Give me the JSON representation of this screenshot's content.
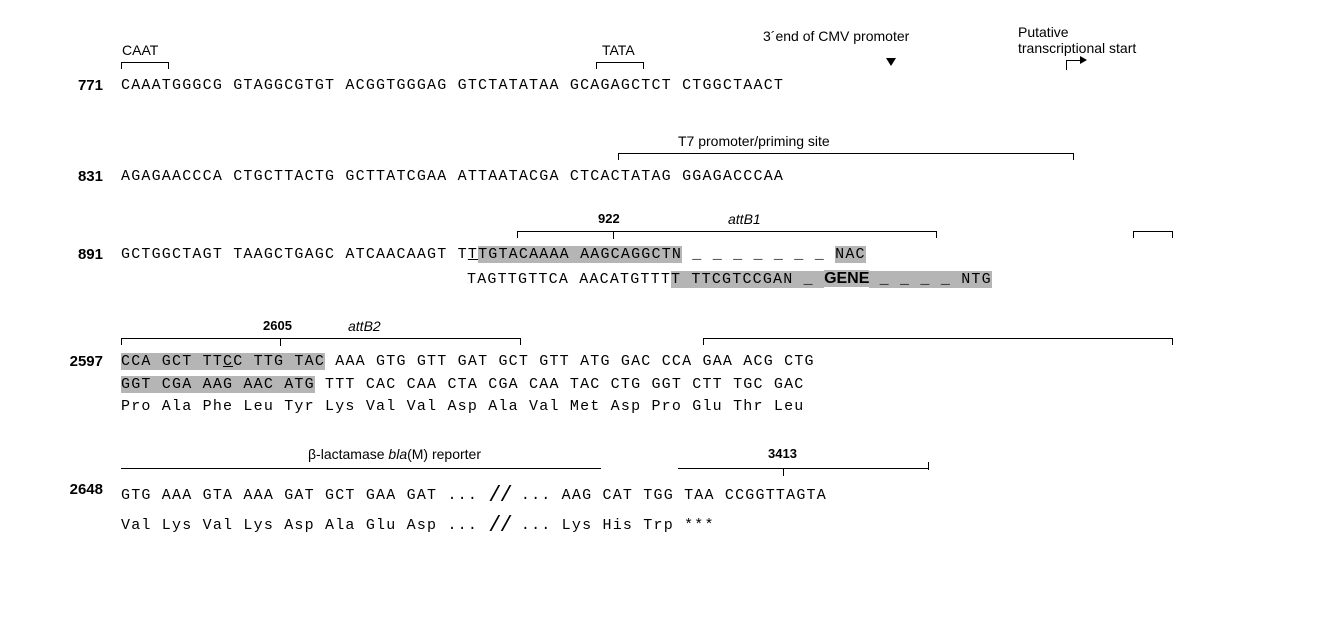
{
  "annotations": {
    "caat": "CAAT",
    "tata": "TATA",
    "cmv_end": "3´end of CMV promoter",
    "trans_start_l1": "Putative",
    "trans_start_l2": "transcriptional start",
    "t7": "T7 promoter/priming site",
    "attB1": "attB1",
    "attB2": "attB2",
    "bla_reporter": "β-lactamase bla(M) reporter",
    "gene": "GENE"
  },
  "positions": {
    "r1": "771",
    "r2": "831",
    "r3": "891",
    "r4": "2597",
    "r5": "2648",
    "mid922": "922",
    "mid2605": "2605",
    "mid3413": "3413"
  },
  "sequences": {
    "r1": "CAAATGGGCG GTAGGCGTGT ACGGTGGGAG GTCTATATAA GCAGAGCTCT CTGGCTAACT",
    "r2": "AGAGAACCCA CTGCTTACTG GCTTATCGAA ATTAATACGA CTCACTATAG GGAGACCCAA",
    "r3_top_a": "GCTGGCTAGT TAAGCTGAGC ATCAACAAGT T",
    "r3_top_b_hl": "TGTACAAAA AAGCAGGCTN",
    "r3_top_c": " _ _ _ _ _ _ _ ",
    "r3_top_d_hl": "NAC",
    "r3_bot_a": "TAGTTGTTCA AACATGTTT",
    "r3_bot_b_hl": "T TTCGTCCGAN ",
    "r3_bot_c": " _ ",
    "r3_bot_d": " _ _ _ _ ",
    "r3_bot_e_hl": " NTG",
    "r4_top_hl": "CCA GCT TT",
    "r4_top_mid": "C TTG TAC",
    "r4_top_rest": " AAA GTG GTT GAT GCT GTT ATG GAC CCA GAA ACG CTG",
    "r4_bot_hl": "GGT CGA AAG AAC ATG",
    "r4_bot_rest": " TTT CAC CAA CTA CGA CAA TAC CTG GGT CTT TGC GAC",
    "r4_aa": "Pro Ala Phe Leu Tyr Lys Val Val Asp Ala Val Met Asp Pro Glu Thr Leu",
    "r5_top_a": "GTG AAA GTA AAA GAT GCT GAA GAT ...",
    "r5_top_b": "... AAG CAT TGG TAA CCGGTTAGTA",
    "r5_aa_a": "Val Lys Val Lys Asp Ala Glu Asp ...",
    "r5_aa_b": "... Lys His Trp ***"
  }
}
